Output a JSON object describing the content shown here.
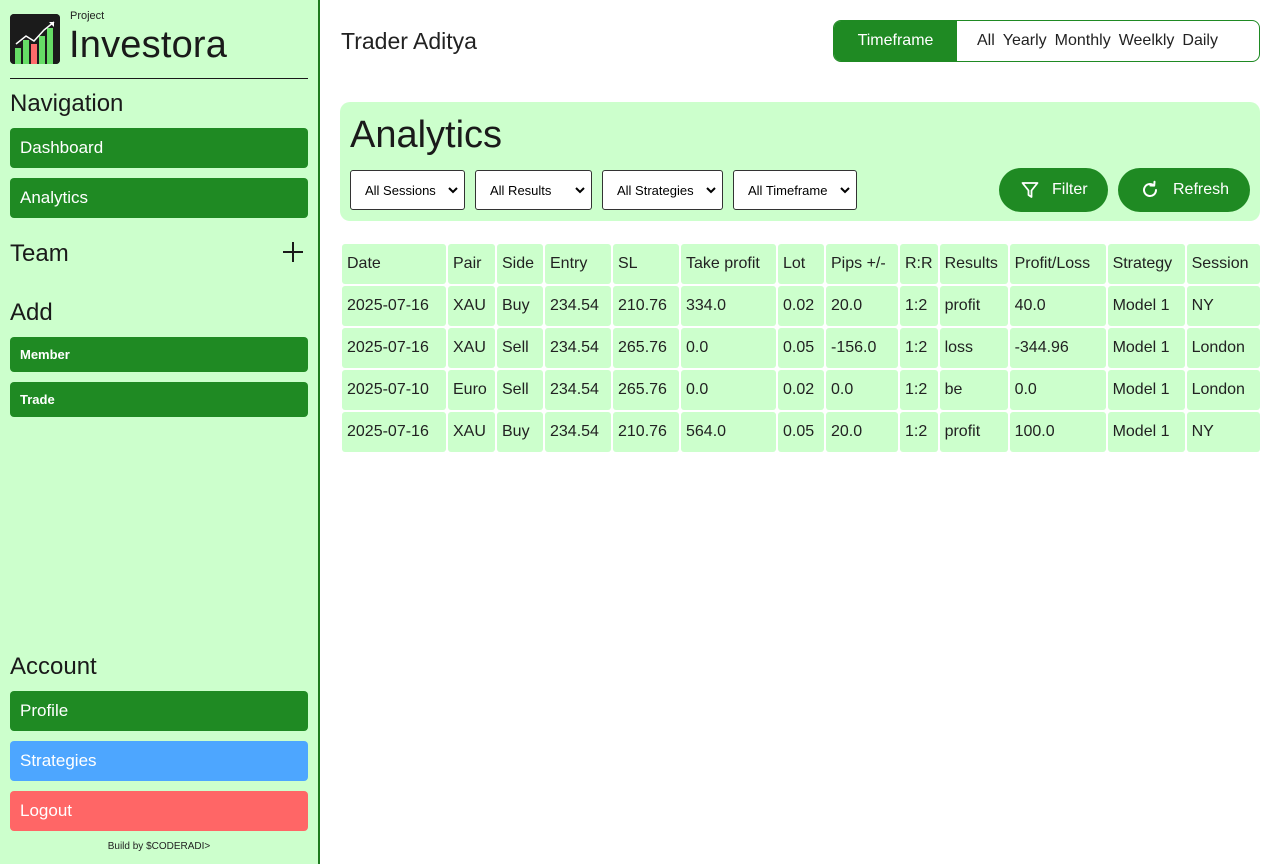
{
  "sidebar": {
    "logo_small": "Project",
    "logo_title": "Investora",
    "navigation_title": "Navigation",
    "nav_items": [
      "Dashboard",
      "Analytics"
    ],
    "team_title": "Team",
    "add_title": "Add",
    "add_items": [
      "Member",
      "Trade"
    ],
    "account_title": "Account",
    "account_items": [
      "Profile",
      "Strategies",
      "Logout"
    ],
    "footer": "Build by $CODERADI>"
  },
  "header": {
    "trader_name": "Trader Aditya",
    "timeframe_label": "Timeframe",
    "timeframe_options": [
      "All",
      "Yearly",
      "Monthly",
      "Weelkly",
      "Daily"
    ]
  },
  "analytics": {
    "title": "Analytics",
    "filters": [
      "All Sessions",
      "All Results",
      "All Strategies",
      "All Timeframe"
    ],
    "filter_button": "Filter",
    "refresh_button": "Refresh"
  },
  "table": {
    "headers": [
      "Date",
      "Pair",
      "Side",
      "Entry",
      "SL",
      "Take profit",
      "Lot",
      "Pips +/-",
      "R:R",
      "Results",
      "Profit/Loss",
      "Strategy",
      "Session"
    ],
    "rows": [
      [
        "2025-07-16",
        "XAU",
        "Buy",
        "234.54",
        "210.76",
        "334.0",
        "0.02",
        "20.0",
        "1:2",
        "profit",
        "40.0",
        "Model 1",
        "NY"
      ],
      [
        "2025-07-16",
        "XAU",
        "Sell",
        "234.54",
        "265.76",
        "0.0",
        "0.05",
        "-156.0",
        "1:2",
        "loss",
        "-344.96",
        "Model 1",
        "London"
      ],
      [
        "2025-07-10",
        "Euro",
        "Sell",
        "234.54",
        "265.76",
        "0.0",
        "0.02",
        "0.0",
        "1:2",
        "be",
        "0.0",
        "Model 1",
        "London"
      ],
      [
        "2025-07-16",
        "XAU",
        "Buy",
        "234.54",
        "210.76",
        "564.0",
        "0.05",
        "20.0",
        "1:2",
        "profit",
        "100.0",
        "Model 1",
        "NY"
      ]
    ]
  },
  "colors": {
    "sidebar_bg": "#ccffcc",
    "primary_green": "#1f8a23",
    "strategies_blue": "#4da6ff",
    "logout_red": "#ff6666"
  }
}
